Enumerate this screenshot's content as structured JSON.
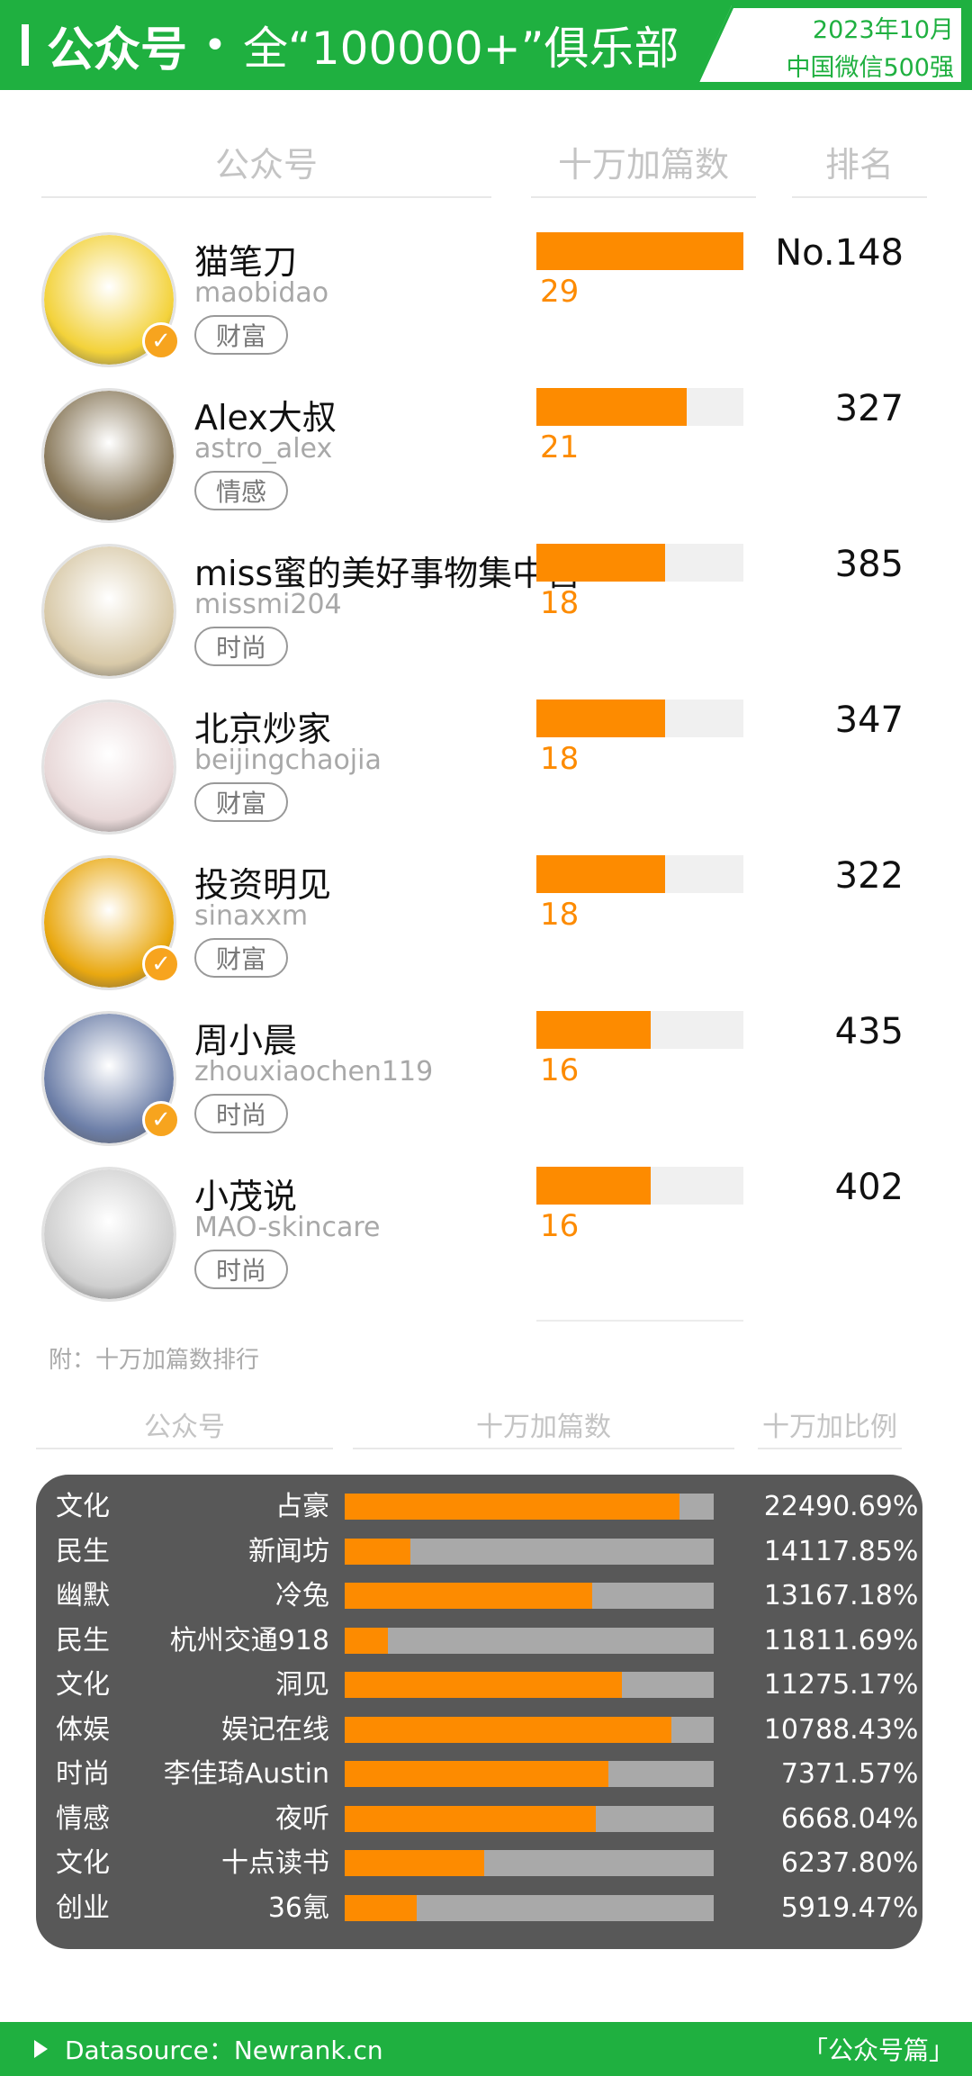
{
  "header": {
    "title_bold": "公众号",
    "separator": "•",
    "title_rest": "全“100000+”俱乐部",
    "badge_line1": "2023年10月",
    "badge_line2": "中国微信500强"
  },
  "top_table": {
    "col_account": "公众号",
    "col_count": "十万加篇数",
    "col_rank": "排名",
    "max_count": 29
  },
  "accounts": [
    {
      "name": "猫笔刀",
      "id": "maobidao",
      "tag": "财富",
      "count": 29,
      "count_label": "29",
      "rank": "No.148",
      "verified": true,
      "avatar_icon": "cartoon-cat-avatar",
      "avatar_color": "#f3d23a"
    },
    {
      "name": "Alex大叔",
      "id": "astro_alex",
      "tag": "情感",
      "count": 21,
      "count_label": "21",
      "rank": "327",
      "verified": false,
      "avatar_icon": "painted-portrait-avatar",
      "avatar_color": "#8a7a5c"
    },
    {
      "name": "miss蜜的美好事物集中营",
      "id": "missmi204",
      "tag": "时尚",
      "count": 18,
      "count_label": "18",
      "rank": "385",
      "verified": false,
      "avatar_icon": "woman-photo-avatar",
      "avatar_color": "#d8c9a8"
    },
    {
      "name": "北京炒家",
      "id": "beijingchaojia",
      "tag": "财富",
      "count": 18,
      "count_label": "18",
      "rank": "347",
      "verified": false,
      "avatar_icon": "monkey-king-avatar",
      "avatar_color": "#e8d8d8"
    },
    {
      "name": "投资明见",
      "id": "sinaxxm",
      "tag": "财富",
      "count": 18,
      "count_label": "18",
      "rank": "322",
      "verified": true,
      "avatar_icon": "man-photo-avatar",
      "avatar_color": "#e9a810"
    },
    {
      "name": "周小晨",
      "id": "zhouxiaochen119",
      "tag": "时尚",
      "count": 16,
      "count_label": "16",
      "rank": "435",
      "verified": true,
      "avatar_icon": "girl-silhouette-avatar",
      "avatar_color": "#6d7fa8"
    },
    {
      "name": "小茂说",
      "id": "MAO-skincare",
      "tag": "时尚",
      "count": 16,
      "count_label": "16",
      "rank": "402",
      "verified": false,
      "avatar_icon": "man-suit-avatar",
      "avatar_color": "#cfcfcf"
    }
  ],
  "appendix": {
    "title": "附：十万加篇数排行",
    "col_account": "公众号",
    "col_count": "十万加篇数",
    "col_ratio": "十万加比例"
  },
  "chart_data": {
    "type": "bar",
    "title": "附：十万加篇数排行",
    "categories": [
      "占豪",
      "新闻坊",
      "冷兔",
      "杭州交通918",
      "洞见",
      "娱记在线",
      "李佳琦Austin",
      "夜听",
      "十点读书",
      "36氪"
    ],
    "groups": [
      "文化",
      "民生",
      "幽默",
      "民生",
      "文化",
      "体娱",
      "时尚",
      "情感",
      "文化",
      "创业"
    ],
    "series": [
      {
        "name": "十万加篇数",
        "values": [
          224,
          141,
          131,
          118,
          112,
          107,
          73,
          66,
          62,
          59
        ]
      },
      {
        "name": "十万加比例",
        "values": [
          90.69,
          17.85,
          67.18,
          11.69,
          75.17,
          88.43,
          71.57,
          68.04,
          37.8,
          19.47
        ]
      }
    ],
    "ratio_labels": [
      "90.69%",
      "17.85%",
      "67.18%",
      "11.69%",
      "75.17%",
      "88.43%",
      "71.57%",
      "68.04%",
      "37.80%",
      "19.47%"
    ],
    "ylim": [
      0,
      100
    ]
  },
  "footer": {
    "source": "Datasource：Newrank.cn",
    "section": "「公众号篇」"
  },
  "colors": {
    "brand_green": "#1fb040",
    "bar_orange": "#fd8b00",
    "panel_gray": "#585858",
    "verified_badge": "#f7a41e"
  }
}
